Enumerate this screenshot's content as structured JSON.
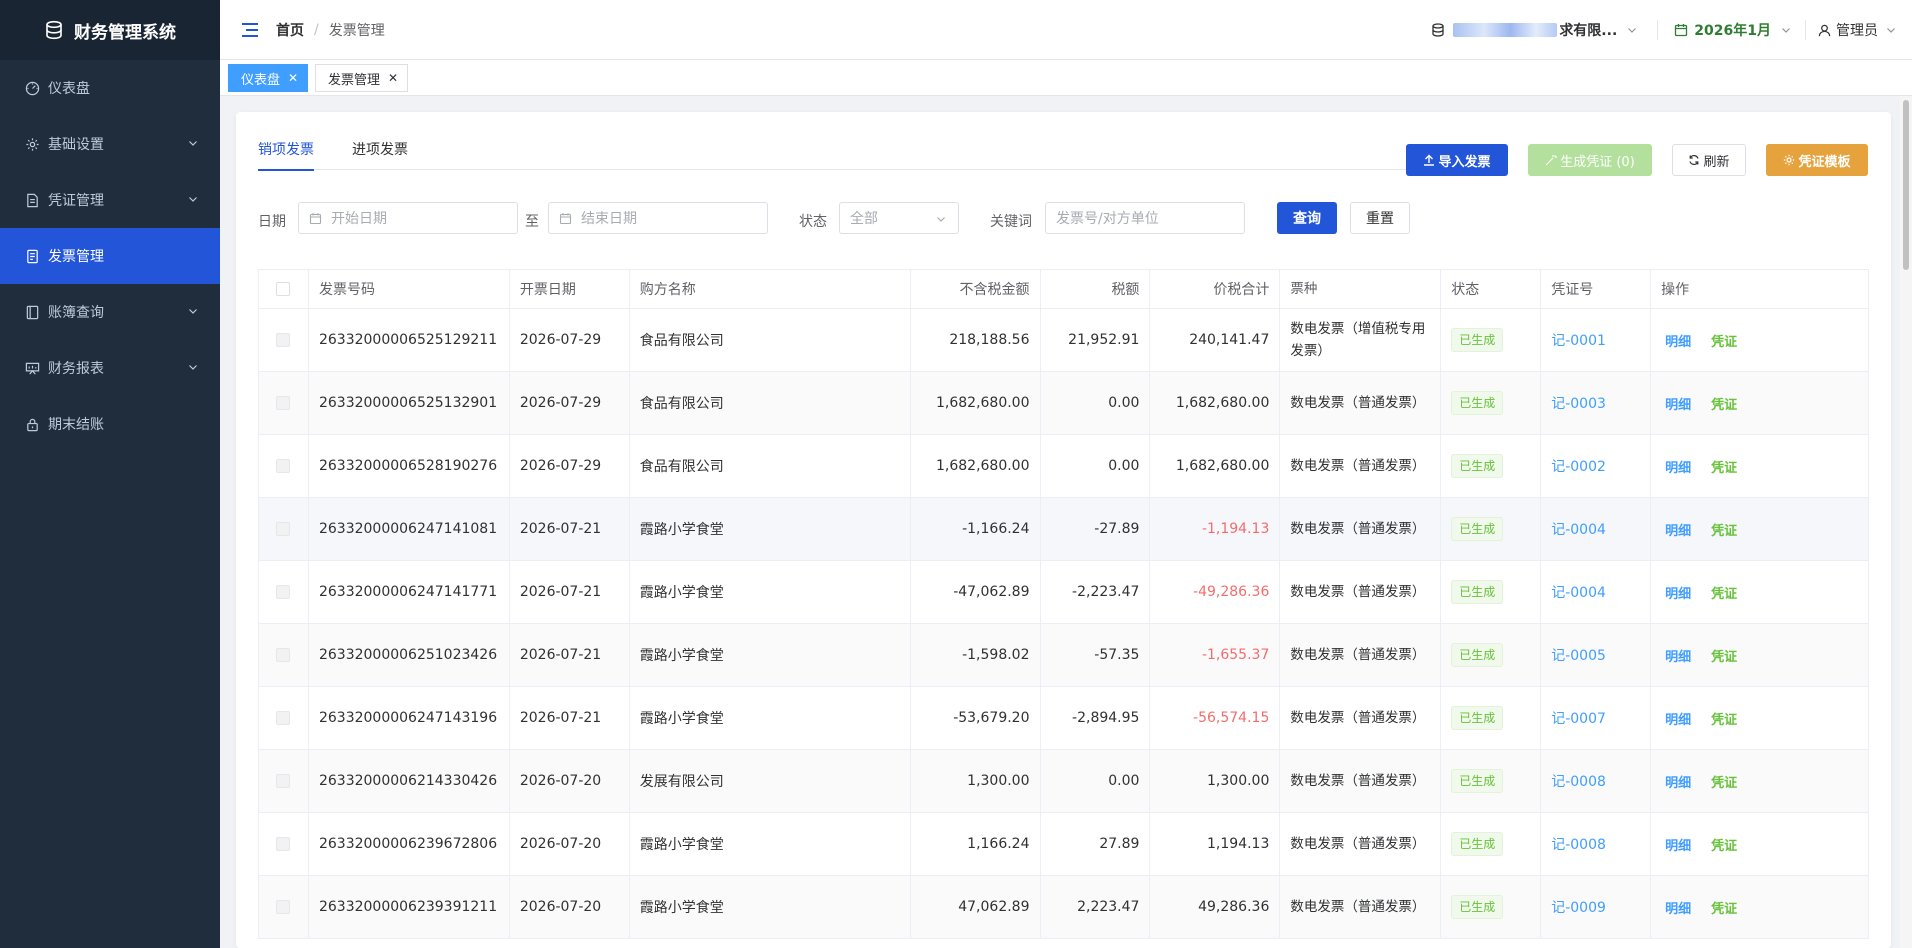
{
  "app": {
    "title": "财务管理系统"
  },
  "sidebar": {
    "items": [
      {
        "label": "仪表盘",
        "icon": "dashboard-icon",
        "expandable": false,
        "active": false
      },
      {
        "label": "基础设置",
        "icon": "gear-icon",
        "expandable": true,
        "active": false
      },
      {
        "label": "凭证管理",
        "icon": "document-icon",
        "expandable": true,
        "active": false
      },
      {
        "label": "发票管理",
        "icon": "invoice-icon",
        "expandable": false,
        "active": true
      },
      {
        "label": "账簿查询",
        "icon": "book-icon",
        "expandable": true,
        "active": false
      },
      {
        "label": "财务报表",
        "icon": "report-icon",
        "expandable": true,
        "active": false
      },
      {
        "label": "期末结账",
        "icon": "lock-icon",
        "expandable": false,
        "active": false
      }
    ]
  },
  "header": {
    "breadcrumb_home": "首页",
    "breadcrumb_sep": "/",
    "breadcrumb_current": "发票管理",
    "company_suffix": "求有限...",
    "period": "2026年1月",
    "user": "管理员"
  },
  "tags": [
    {
      "label": "仪表盘",
      "active": true
    },
    {
      "label": "发票管理",
      "active": false
    }
  ],
  "tabs": {
    "sales": "销项发票",
    "purchase": "进项发票"
  },
  "toolbar": {
    "import": "导入发票",
    "generate": "生成凭证 (0)",
    "refresh": "刷新",
    "template": "凭证模板"
  },
  "filters": {
    "date_label": "日期",
    "start_placeholder": "开始日期",
    "to_label": "至",
    "end_placeholder": "结束日期",
    "status_label": "状态",
    "status_value": "全部",
    "keyword_label": "关键词",
    "keyword_placeholder": "发票号/对方单位",
    "query": "查询",
    "reset": "重置"
  },
  "table": {
    "headers": [
      "发票号码",
      "开票日期",
      "购方名称",
      "不含税金额",
      "税额",
      "价税合计",
      "票种",
      "状态",
      "凭证号",
      "操作"
    ],
    "detail_label": "明细",
    "voucher_label": "凭证",
    "rows": [
      {
        "no": "26332000006525129211",
        "date": "2026-07-29",
        "buyer": "食品有限公司",
        "amount": "218,188.56",
        "tax": "21,952.91",
        "total": "240,141.47",
        "kind": "数电发票（增值税专用发票）",
        "status": "已生成",
        "voucher": "记-0001",
        "negative": false
      },
      {
        "no": "26332000006525132901",
        "date": "2026-07-29",
        "buyer": "食品有限公司",
        "amount": "1,682,680.00",
        "tax": "0.00",
        "total": "1,682,680.00",
        "kind": "数电发票（普通发票）",
        "status": "已生成",
        "voucher": "记-0003",
        "negative": false
      },
      {
        "no": "26332000006528190276",
        "date": "2026-07-29",
        "buyer": "食品有限公司",
        "amount": "1,682,680.00",
        "tax": "0.00",
        "total": "1,682,680.00",
        "kind": "数电发票（普通发票）",
        "status": "已生成",
        "voucher": "记-0002",
        "negative": false
      },
      {
        "no": "26332000006247141081",
        "date": "2026-07-21",
        "buyer": "霞路小学食堂",
        "amount": "-1,166.24",
        "tax": "-27.89",
        "total": "-1,194.13",
        "kind": "数电发票（普通发票）",
        "status": "已生成",
        "voucher": "记-0004",
        "negative": true
      },
      {
        "no": "26332000006247141771",
        "date": "2026-07-21",
        "buyer": "霞路小学食堂",
        "amount": "-47,062.89",
        "tax": "-2,223.47",
        "total": "-49,286.36",
        "kind": "数电发票（普通发票）",
        "status": "已生成",
        "voucher": "记-0004",
        "negative": true
      },
      {
        "no": "26332000006251023426",
        "date": "2026-07-21",
        "buyer": "霞路小学食堂",
        "amount": "-1,598.02",
        "tax": "-57.35",
        "total": "-1,655.37",
        "kind": "数电发票（普通发票）",
        "status": "已生成",
        "voucher": "记-0005",
        "negative": true
      },
      {
        "no": "26332000006247143196",
        "date": "2026-07-21",
        "buyer": "霞路小学食堂",
        "amount": "-53,679.20",
        "tax": "-2,894.95",
        "total": "-56,574.15",
        "kind": "数电发票（普通发票）",
        "status": "已生成",
        "voucher": "记-0007",
        "negative": true
      },
      {
        "no": "26332000006214330426",
        "date": "2026-07-20",
        "buyer": "发展有限公司",
        "amount": "1,300.00",
        "tax": "0.00",
        "total": "1,300.00",
        "kind": "数电发票（普通发票）",
        "status": "已生成",
        "voucher": "记-0008",
        "negative": false
      },
      {
        "no": "26332000006239672806",
        "date": "2026-07-20",
        "buyer": "霞路小学食堂",
        "amount": "1,166.24",
        "tax": "27.89",
        "total": "1,194.13",
        "kind": "数电发票（普通发票）",
        "status": "已生成",
        "voucher": "记-0008",
        "negative": false
      },
      {
        "no": "26332000006239391211",
        "date": "2026-07-20",
        "buyer": "霞路小学食堂",
        "amount": "47,062.89",
        "tax": "2,223.47",
        "total": "49,286.36",
        "kind": "数电发票（普通发票）",
        "status": "已生成",
        "voucher": "记-0009",
        "negative": false
      }
    ]
  },
  "colors": {
    "primary": "#2255d8",
    "success": "#67c23a",
    "warning": "#e6a23c",
    "danger": "#f56c6c",
    "sidebar_bg": "#1f2d3d"
  }
}
